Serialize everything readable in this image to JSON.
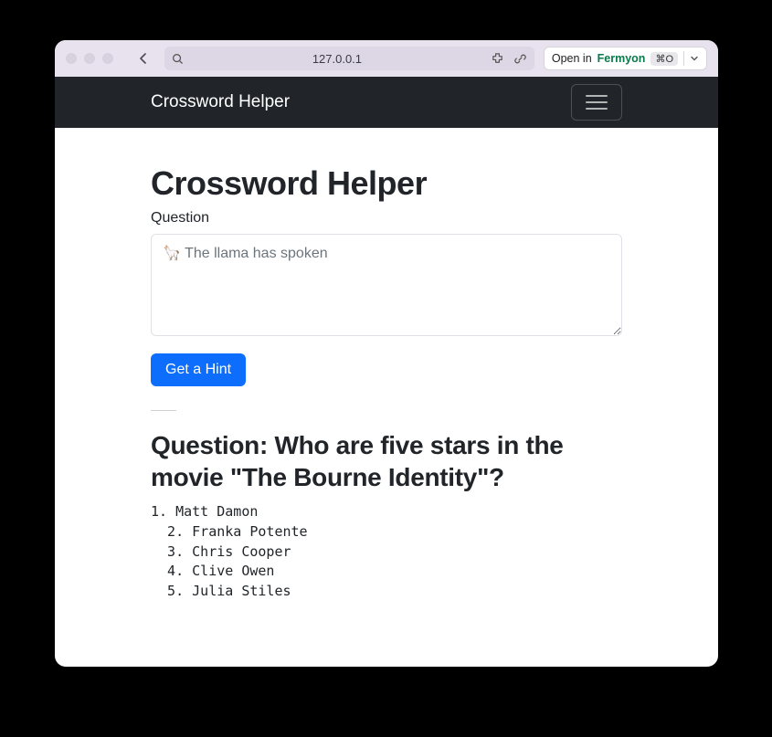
{
  "browser": {
    "url": "127.0.0.1",
    "open_in_prefix": "Open in ",
    "open_in_target": "Fermyon",
    "shortcut": "⌘O"
  },
  "navbar": {
    "brand": "Crossword Helper"
  },
  "page": {
    "heading": "Crossword Helper",
    "question_label": "Question",
    "textarea_placeholder": "🦙 The llama has spoken",
    "textarea_value": "",
    "submit_label": "Get a Hint",
    "result_heading": "Question: Who are five stars in the movie \"The Bourne Identity\"?",
    "result_body": "1. Matt Damon\n  2. Franka Potente\n  3. Chris Cooper\n  4. Clive Owen\n  5. Julia Stiles"
  }
}
